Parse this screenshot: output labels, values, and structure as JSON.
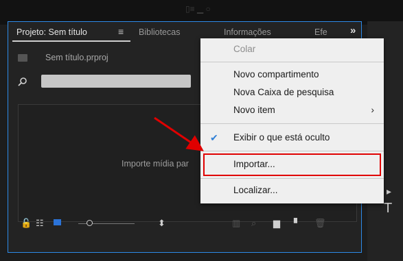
{
  "panel": {
    "tabs": [
      "Projeto: Sem título",
      "Bibliotecas",
      "Informações",
      "Efe"
    ],
    "overflow": "»",
    "project_file": "Sem título.prproj",
    "drop_hint": "Importe mídia par"
  },
  "context_menu": {
    "items": [
      {
        "label": "Colar",
        "disabled": true
      },
      {
        "label": "Novo compartimento"
      },
      {
        "label": "Nova Caixa de pesquisa"
      },
      {
        "label": "Novo item",
        "submenu": true
      },
      {
        "label": "Exibir o que está oculto",
        "checked": true
      },
      {
        "label": "Importar...",
        "highlighted": true
      },
      {
        "label": "Localizar...",
        "disabled": true
      }
    ]
  },
  "colors": {
    "annotation": "#e00000",
    "focus_border": "#2d8ceb"
  },
  "tools": {
    "type_tool": "T"
  }
}
